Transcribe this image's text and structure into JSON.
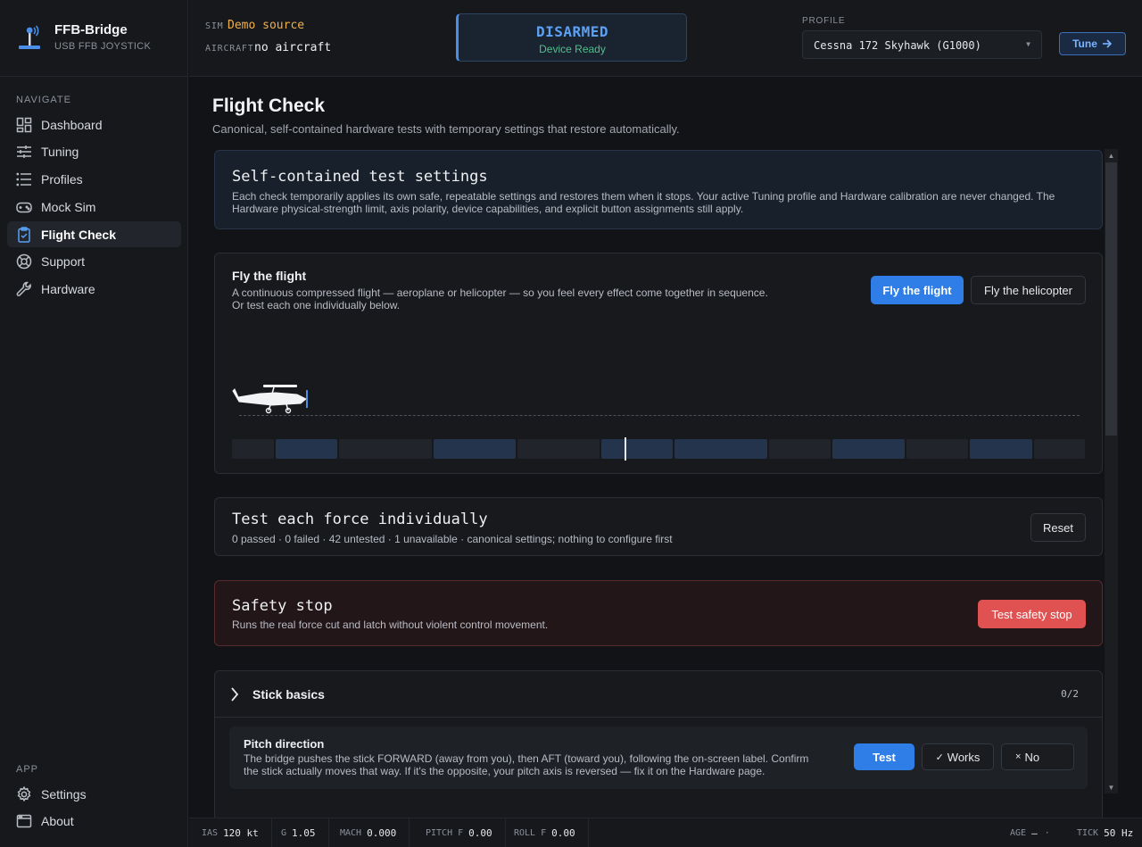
{
  "brand": {
    "title": "FFB-Bridge",
    "subtitle": "USB FFB JOYSTICK"
  },
  "sidebar": {
    "navigate_heading": "NAVIGATE",
    "items": [
      {
        "label": "Dashboard",
        "icon": "dashboard-icon"
      },
      {
        "label": "Tuning",
        "icon": "sliders-icon"
      },
      {
        "label": "Profiles",
        "icon": "list-icon"
      },
      {
        "label": "Mock Sim",
        "icon": "gamepad-icon"
      },
      {
        "label": "Flight Check",
        "icon": "clipboard-check-icon",
        "active": true
      },
      {
        "label": "Support",
        "icon": "lifebuoy-icon"
      },
      {
        "label": "Hardware",
        "icon": "wrench-icon"
      }
    ],
    "app_heading": "APP",
    "app_items": [
      {
        "label": "Settings",
        "icon": "gear-icon"
      },
      {
        "label": "About",
        "icon": "window-icon"
      }
    ]
  },
  "header": {
    "sim_label": "SIM",
    "sim_value": "Demo source",
    "aircraft_label": "AIRCRAFT",
    "aircraft_value": "no aircraft",
    "status_title": "DISARMED",
    "status_sub": "Device Ready",
    "profile_label": "PROFILE",
    "profile_value": "Cessna 172 Skyhawk (G1000)",
    "tune_label": "Tune",
    "colors": {
      "accent": "#2f7de6",
      "sim": "#f0b04a",
      "ready": "#4fc08a",
      "danger": "#e05252"
    }
  },
  "page": {
    "title": "Flight Check",
    "subtitle": "Canonical, self-contained hardware tests with temporary settings that restore automatically."
  },
  "settings_card": {
    "title": "Self-contained test settings",
    "desc": "Each check temporarily applies its own safe, repeatable settings and restores them when it stops. Your active Tuning profile and Hardware calibration are never changed. The Hardware physical-strength limit, axis polarity, device capabilities, and explicit button assignments still apply."
  },
  "fly_card": {
    "title": "Fly the flight",
    "desc1": "A continuous compressed flight — aeroplane or helicopter — so you feel every effect come together in sequence.",
    "desc2": "Or test each one individually below.",
    "btn_flight": "Fly the flight",
    "btn_heli": "Fly the helicopter",
    "timeline": [
      {
        "w": 47,
        "hl": false
      },
      {
        "w": 70,
        "hl": true
      },
      {
        "w": 105,
        "hl": false
      },
      {
        "w": 93,
        "hl": true
      },
      {
        "w": 93,
        "hl": false
      },
      {
        "w": 81,
        "hl": true
      },
      {
        "w": 105,
        "hl": true
      },
      {
        "w": 70,
        "hl": false
      },
      {
        "w": 82,
        "hl": true
      },
      {
        "w": 70,
        "hl": false
      },
      {
        "w": 70,
        "hl": true
      },
      {
        "w": 58,
        "hl": false
      }
    ],
    "playhead_fraction": 0.46
  },
  "individual_card": {
    "title": "Test each force individually",
    "summary": "0 passed · 0 failed · 42 untested · 1 unavailable · canonical settings; nothing to configure first",
    "reset_label": "Reset"
  },
  "safety_card": {
    "title": "Safety stop",
    "desc": "Runs the real force cut and latch without violent control movement.",
    "btn_label": "Test safety stop"
  },
  "stick_basics": {
    "title": "Stick basics",
    "count": "0/2",
    "item_title": "Pitch direction",
    "item_desc1": "The bridge pushes the stick FORWARD (away from you), then AFT (toward you), following the on-screen label. Confirm",
    "item_desc2": "the stick actually moves that way. If it's the opposite, your pitch axis is reversed — fix it on the Hardware page.",
    "btn_test": "Test",
    "btn_works": "Works",
    "btn_no": "No"
  },
  "footer": {
    "ias_label": "IAS",
    "ias_value": "120 kt",
    "g_label": "G",
    "g_value": "1.05",
    "mach_label": "MACH",
    "mach_value": "0.000",
    "pitchf_label": "PITCH F",
    "pitchf_value": "0.00",
    "rollf_label": "ROLL F",
    "rollf_value": "0.00",
    "age_label": "AGE",
    "age_value": "—",
    "tick_label": "TICK",
    "tick_value": "50 Hz"
  }
}
